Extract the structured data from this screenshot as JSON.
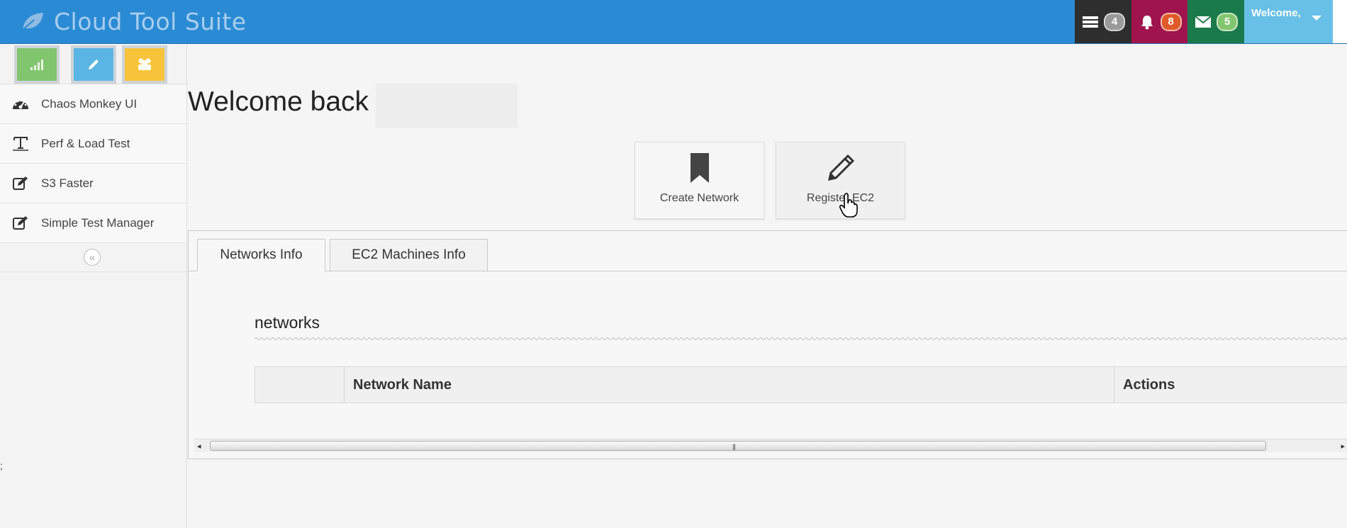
{
  "app": {
    "title": "Cloud Tool Suite"
  },
  "navbar": {
    "tasks_count": "4",
    "notifications_count": "8",
    "messages_count": "5",
    "user_label": "Welcome,",
    "colors": {
      "bar": "#2a8bd4",
      "tasks": "#2e2e2e",
      "notifications": "#a0144e",
      "messages": "#1b7a4c",
      "user": "#68bfe8"
    }
  },
  "sidebar": {
    "shortcuts": [
      {
        "icon": "signal-icon"
      },
      {
        "icon": "pencil-icon"
      },
      {
        "icon": "group-icon"
      }
    ],
    "items": [
      {
        "label": "Chaos Monkey UI",
        "icon": "dashboard-icon"
      },
      {
        "label": "Perf & Load Test",
        "icon": "text-icon"
      },
      {
        "label": "S3 Faster",
        "icon": "edit-icon"
      },
      {
        "label": "Simple Test Manager",
        "icon": "edit-icon"
      }
    ],
    "collapse_glyph": "«",
    "side_mark": ";"
  },
  "main": {
    "welcome": "Welcome back",
    "actions": [
      {
        "label": "Create Network",
        "icon": "bookmark-icon"
      },
      {
        "label": "Register EC2",
        "icon": "pencil-icon"
      }
    ],
    "tabs": [
      {
        "label": "Networks Info",
        "active": true
      },
      {
        "label": "EC2 Machines Info",
        "active": false
      }
    ],
    "section_title": "networks",
    "table": {
      "columns": [
        "",
        "Network Name",
        "Actions"
      ]
    },
    "scrollbar": {
      "left": "◂",
      "right": "▸",
      "grip": "|||"
    }
  }
}
